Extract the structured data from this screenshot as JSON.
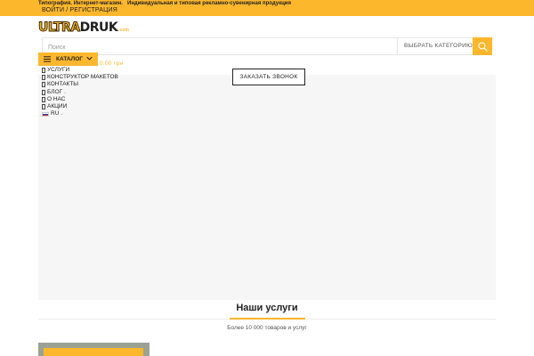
{
  "topbar": {
    "left_text": "Типография. Интернет-магазин.",
    "right_text": "Индивидуальная и типовая рекламно-сувенирная продукция",
    "login": "Войти",
    "separator": "/",
    "register": "Регистрация"
  },
  "logo": {
    "part1": "ULTRA",
    "part2": "DRUK",
    "suffix": ".com"
  },
  "search": {
    "placeholder": "Поиск",
    "category_label": "Выбрать категорию"
  },
  "catalog": {
    "label": "Каталог"
  },
  "cart": {
    "price": "0.00 грн"
  },
  "callback": {
    "label": "Заказать звонок"
  },
  "nav": {
    "items": [
      {
        "label": "Услуги",
        "dropdown": false
      },
      {
        "label": "Конструктор макетов",
        "dropdown": false
      },
      {
        "label": "Контакты",
        "dropdown": false
      },
      {
        "label": "Блог",
        "dropdown": true
      },
      {
        "label": "О нас",
        "dropdown": false
      },
      {
        "label": "Акции",
        "dropdown": false
      }
    ],
    "language": "RU"
  },
  "services": {
    "title": "Наши услуги",
    "subtitle": "Более 10 000 товаров и услуг"
  },
  "colors": {
    "accent": "#fdb72c",
    "text": "#222222",
    "hero_bg": "#f6f6f6"
  }
}
